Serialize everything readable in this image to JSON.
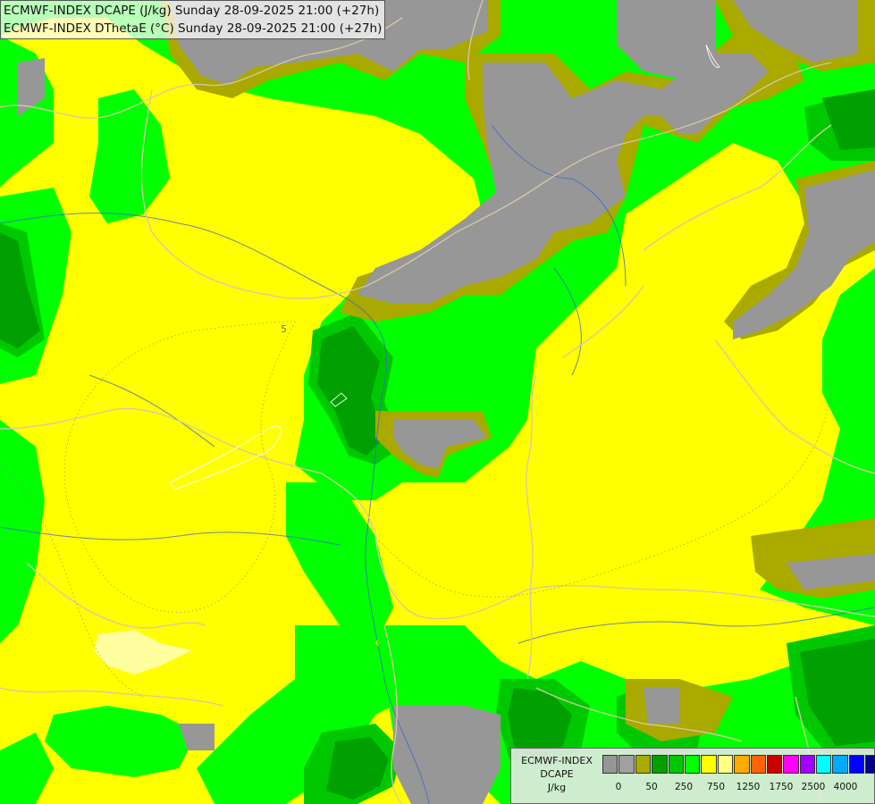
{
  "titles": {
    "line1": "ECMWF-INDEX DCAPE (J/kg) Sunday 28-09-2025 21:00 (+27h)",
    "line2": "ECMWF-INDEX DThetaE (°C) Sunday 28-09-2025 21:00 (+27h)"
  },
  "legend": {
    "title_lines": [
      "ECMWF-INDEX",
      "DCAPE",
      "J/kg"
    ],
    "colors": [
      "#969696",
      "#a0a0a0",
      "#aaaa00",
      "#00a000",
      "#00c800",
      "#00ff00",
      "#ffff00",
      "#ffff80",
      "#ffaa00",
      "#ff6400",
      "#c80000",
      "#ff00ff",
      "#a000ff",
      "#00ffff",
      "#00aaff",
      "#0000ff",
      "#00008c"
    ],
    "tick_labels": [
      "0",
      "50",
      "250",
      "750",
      "1250",
      "1750",
      "2500",
      "4000"
    ]
  },
  "contour_label": "5",
  "colors": {
    "grey": "#979797",
    "olive": "#a9a900",
    "dark_green": "#00a000",
    "green": "#00ff00",
    "mid_green": "#00c800",
    "yellow": "#ffff00",
    "pale_yellow": "#ffffa0",
    "border": "#d8c7a6",
    "river": "#3c64c8"
  }
}
